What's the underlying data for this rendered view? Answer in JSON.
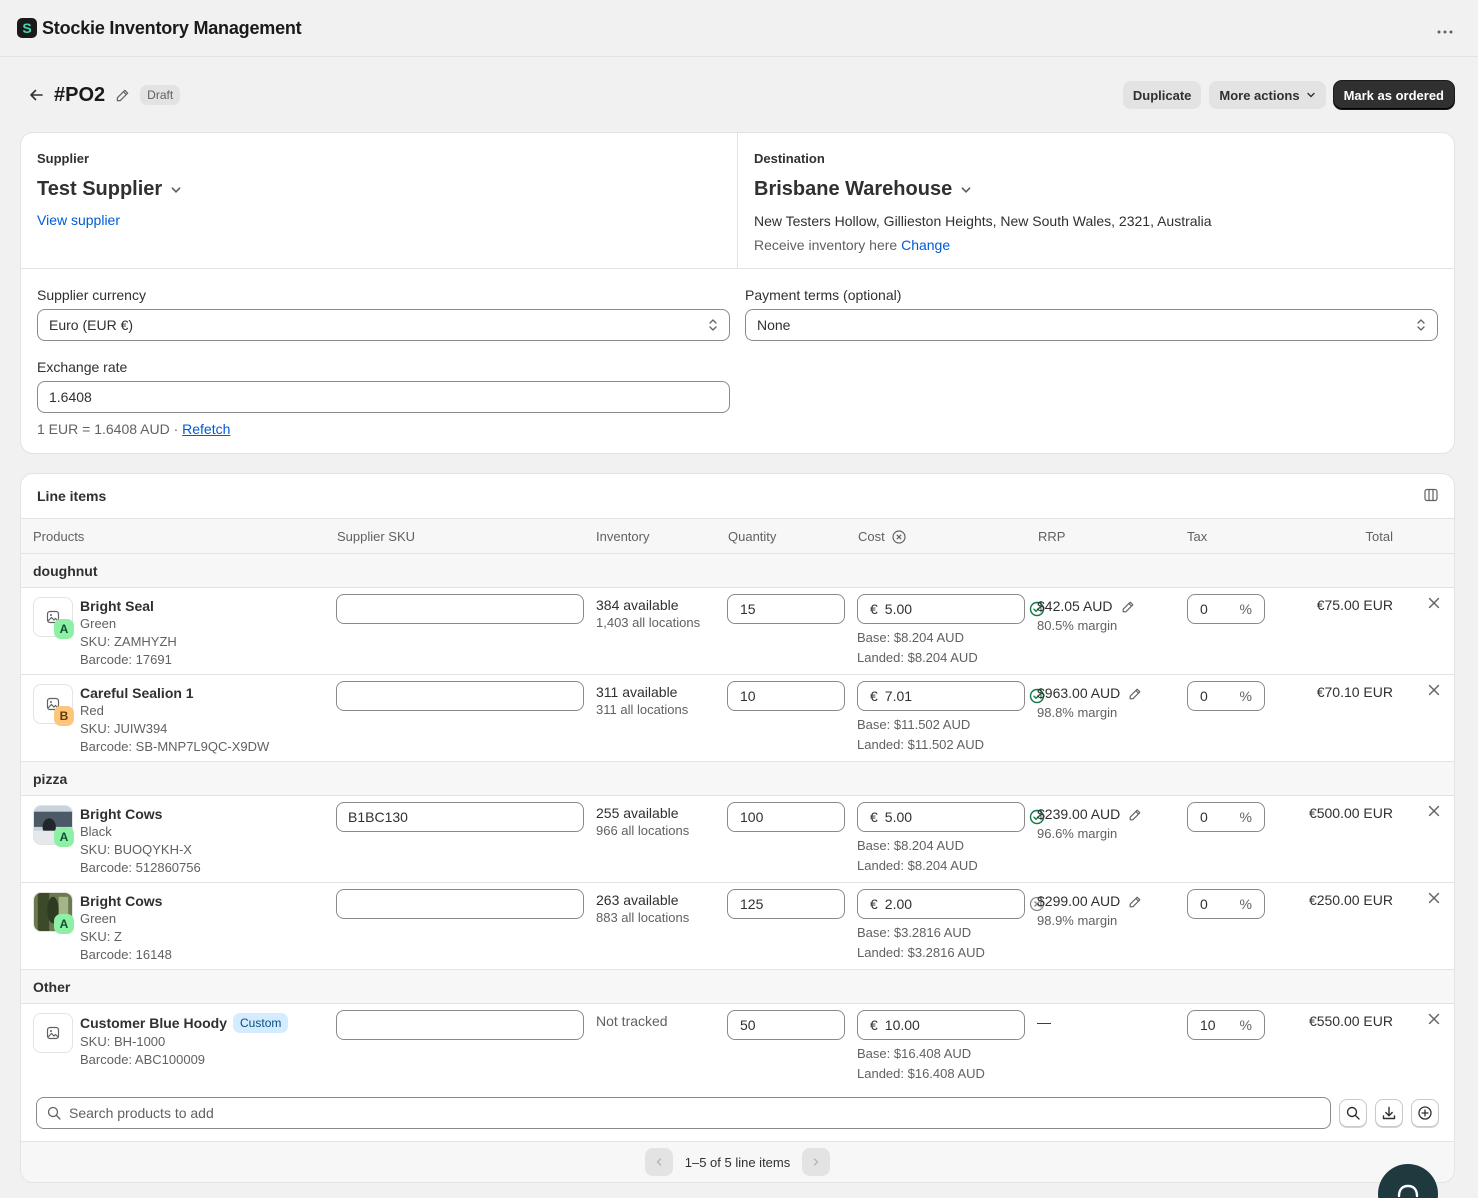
{
  "app": {
    "title": "Stockie Inventory Management",
    "logo_letter": "S"
  },
  "page": {
    "title": "#PO2",
    "status": "Draft",
    "actions": {
      "duplicate": "Duplicate",
      "more": "More actions",
      "primary": "Mark as ordered"
    }
  },
  "supplier": {
    "label": "Supplier",
    "name": "Test Supplier",
    "link": "View supplier"
  },
  "destination": {
    "label": "Destination",
    "name": "Brisbane Warehouse",
    "address": "New Testers Hollow, Gillieston Heights, New South Wales, 2321, Australia",
    "receive_text": "Receive inventory here",
    "change_link": "Change"
  },
  "form": {
    "currency_label": "Supplier currency",
    "currency_value": "Euro (EUR €)",
    "terms_label": "Payment terms (optional)",
    "terms_value": "None",
    "rate_label": "Exchange rate",
    "rate_value": "1.6408",
    "rate_note": "1 EUR = 1.6408 AUD · ",
    "refetch": "Refetch"
  },
  "line_items": {
    "title": "Line items",
    "columns": [
      "Products",
      "Supplier SKU",
      "Inventory",
      "Quantity",
      "Cost",
      "RRP",
      "Tax",
      "Total"
    ],
    "groups": {
      "g1": "doughnut",
      "g2": "pizza",
      "g3": "Other"
    },
    "items": [
      {
        "name": "Bright Seal",
        "variant": "Green",
        "sku": "SKU: ZAMHYZH",
        "barcode": "Barcode: 17691",
        "grade": "A",
        "supplier_sku": "",
        "available": "384 available",
        "locations": "1,403 all locations",
        "qty": "15",
        "currency": "€",
        "cost": "5.00",
        "base": "Base: $8.204 AUD",
        "landed": "Landed: $8.204 AUD",
        "rrp": "$42.05 AUD",
        "margin": "80.5% margin",
        "tax": "0",
        "total": "€75.00 EUR",
        "cost_status": "ok"
      },
      {
        "name": "Careful Sealion 1",
        "variant": "Red",
        "sku": "SKU: JUIW394",
        "barcode": "Barcode: SB-MNP7L9QC-X9DW",
        "grade": "B",
        "supplier_sku": "",
        "available": "311 available",
        "locations": "311 all locations",
        "qty": "10",
        "currency": "€",
        "cost": "7.01",
        "base": "Base: $11.502 AUD",
        "landed": "Landed: $11.502 AUD",
        "rrp": "$963.00 AUD",
        "margin": "98.8% margin",
        "tax": "0",
        "total": "€70.10 EUR",
        "cost_status": "ok"
      },
      {
        "name": "Bright Cows",
        "variant": "Black",
        "sku": "SKU: BUOQYKH-X",
        "barcode": "Barcode: 512860756",
        "grade": "A",
        "supplier_sku": "B1BC130",
        "available": "255 available",
        "locations": "966 all locations",
        "qty": "100",
        "currency": "€",
        "cost": "5.00",
        "base": "Base: $8.204 AUD",
        "landed": "Landed: $8.204 AUD",
        "rrp": "$239.00 AUD",
        "margin": "96.6% margin",
        "tax": "0",
        "total": "€500.00 EUR",
        "cost_status": "ok"
      },
      {
        "name": "Bright Cows",
        "variant": "Green",
        "sku": "SKU: Z",
        "barcode": "Barcode: 16148",
        "grade": "A",
        "supplier_sku": "",
        "available": "263 available",
        "locations": "883 all locations",
        "qty": "125",
        "currency": "€",
        "cost": "2.00",
        "base": "Base: $3.2816 AUD",
        "landed": "Landed: $3.2816 AUD",
        "rrp": "$299.00 AUD",
        "margin": "98.9% margin",
        "tax": "0",
        "total": "€250.00 EUR",
        "cost_status": "unset"
      },
      {
        "name": "Customer Blue Hoody",
        "badge": "Custom",
        "sku": "SKU: BH-1000",
        "barcode": "Barcode: ABC100009",
        "supplier_sku": "",
        "available": "Not tracked",
        "qty": "50",
        "currency": "€",
        "cost": "10.00",
        "base": "Base: $16.408 AUD",
        "landed": "Landed: $16.408 AUD",
        "rrp": "—",
        "tax": "10",
        "total": "€550.00 EUR"
      }
    ],
    "tax_suffix": "%",
    "search_placeholder": "Search products to add",
    "pagination": "1–5 of 5 line items"
  },
  "icons": [
    "menu-dots-icon",
    "back-arrow-icon",
    "pencil-icon",
    "chevron-down-icon",
    "select-arrows-icon",
    "columns-icon",
    "cancel-circle-icon",
    "image-placeholder-icon",
    "check-circle-icon",
    "close-icon",
    "search-icon",
    "download-icon",
    "plus-circle-icon",
    "chat-icon"
  ],
  "colors": {
    "primary_button": "#303030",
    "link": "#005bd3",
    "grade_a": "#8ef0a5",
    "grade_b": "#ffc57a",
    "success": "#0c7a43",
    "custom_badge": "#d5ebff"
  }
}
